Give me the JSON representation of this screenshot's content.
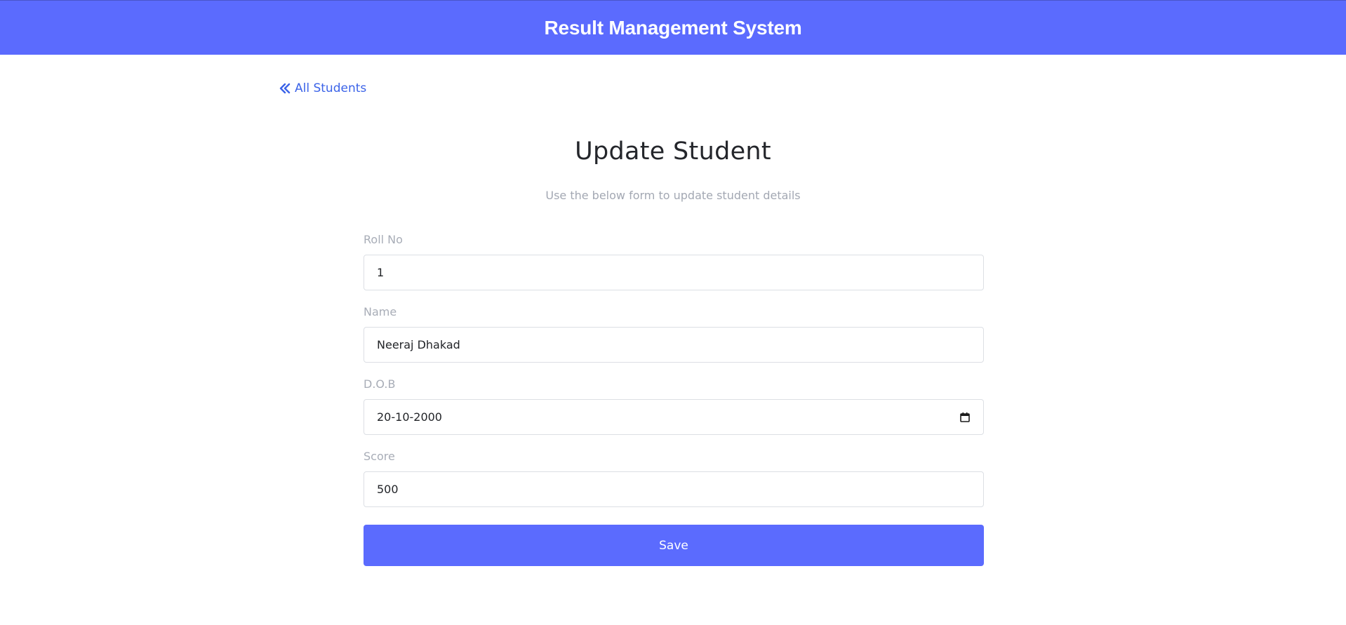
{
  "header": {
    "title": "Result Management System"
  },
  "nav": {
    "back_label": "All Students",
    "back_icon": "double-chevron-left-icon"
  },
  "page": {
    "title": "Update Student",
    "subtitle": "Use the below form to update student details"
  },
  "form": {
    "fields": [
      {
        "label": "Roll No",
        "value": "1"
      },
      {
        "label": "Name",
        "value": "Neeraj Dhakad"
      },
      {
        "label": "D.O.B",
        "value": "20-10-2000",
        "icon": "calendar-icon"
      },
      {
        "label": "Score",
        "value": "500"
      }
    ],
    "save_label": "Save"
  },
  "colors": {
    "accent": "#5b6bfe",
    "link": "#3b63e8",
    "muted_text": "#a8adb7"
  }
}
